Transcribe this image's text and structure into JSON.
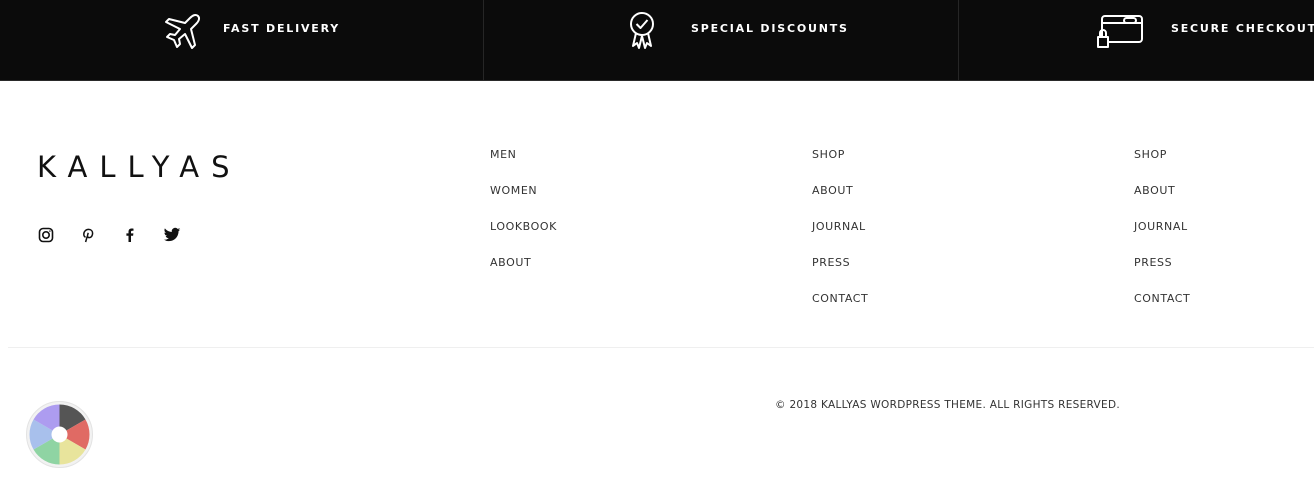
{
  "features": [
    {
      "label": "FAST DELIVERY",
      "icon": "airplane-icon"
    },
    {
      "label": "SPECIAL DISCOUNTS",
      "icon": "award-ribbon-icon"
    },
    {
      "label": "SECURE CHECKOUT",
      "icon": "credit-card-lock-icon"
    }
  ],
  "logo": {
    "text": "KALLYAS"
  },
  "socials": [
    "instagram-icon",
    "pinterest-icon",
    "facebook-icon",
    "twitter-icon"
  ],
  "menus": [
    {
      "items": [
        "MEN",
        "WOMEN",
        "LOOKBOOK",
        "ABOUT"
      ]
    },
    {
      "items": [
        "SHOP",
        "ABOUT",
        "JOURNAL",
        "PRESS",
        "CONTACT"
      ]
    },
    {
      "items": [
        "SHOP",
        "ABOUT",
        "JOURNAL",
        "PRESS",
        "CONTACT"
      ]
    }
  ],
  "footer": {
    "copyright": "© 2018 KALLYAS WORDPRESS THEME. ALL RIGHTS RESERVED."
  },
  "colors": {
    "bar_bg": "#0b0b0b",
    "wheel": [
      "#555555",
      "#e06a64",
      "#e8e49c",
      "#8fd4a3",
      "#a8c0ec",
      "#ad9cf0"
    ]
  }
}
